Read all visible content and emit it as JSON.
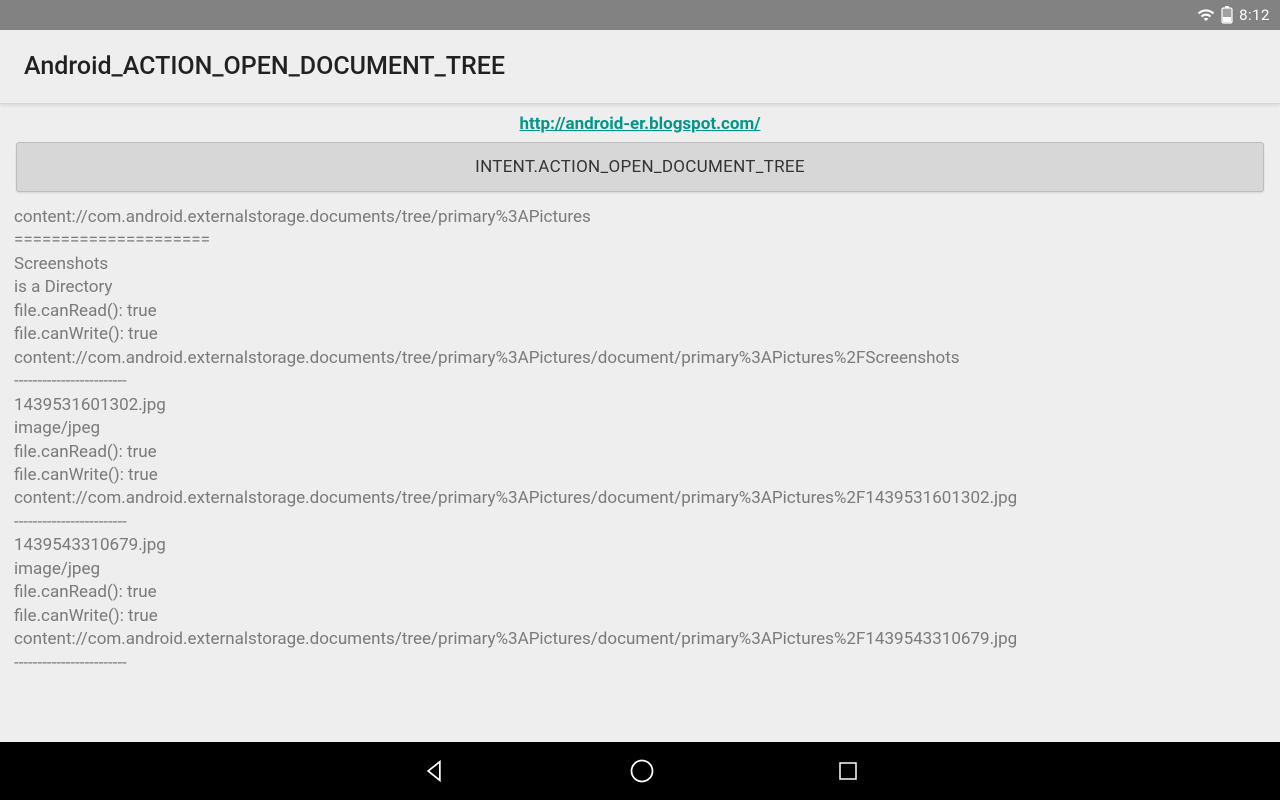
{
  "status": {
    "time": "8:12"
  },
  "appbar": {
    "title": "Android_ACTION_OPEN_DOCUMENT_TREE"
  },
  "link": {
    "url": "http://android-er.blogspot.com/",
    "text": "http://android-er.blogspot.com/"
  },
  "button": {
    "label": "INTENT.ACTION_OPEN_DOCUMENT_TREE"
  },
  "output": {
    "root_uri": "content://com.android.externalstorage.documents/tree/primary%3APictures",
    "separator_major": "=====================",
    "separator_minor": "------------------------",
    "entries": [
      {
        "name": "Screenshots",
        "type": "is a Directory",
        "canRead": "file.canRead(): true",
        "canWrite": "file.canWrite(): true",
        "uri": "content://com.android.externalstorage.documents/tree/primary%3APictures/document/primary%3APictures%2FScreenshots"
      },
      {
        "name": "1439531601302.jpg",
        "type": "image/jpeg",
        "canRead": "file.canRead(): true",
        "canWrite": "file.canWrite(): true",
        "uri": "content://com.android.externalstorage.documents/tree/primary%3APictures/document/primary%3APictures%2F1439531601302.jpg"
      },
      {
        "name": "1439543310679.jpg",
        "type": "image/jpeg",
        "canRead": "file.canRead(): true",
        "canWrite": "file.canWrite(): true",
        "uri": "content://com.android.externalstorage.documents/tree/primary%3APictures/document/primary%3APictures%2F1439543310679.jpg"
      }
    ]
  }
}
